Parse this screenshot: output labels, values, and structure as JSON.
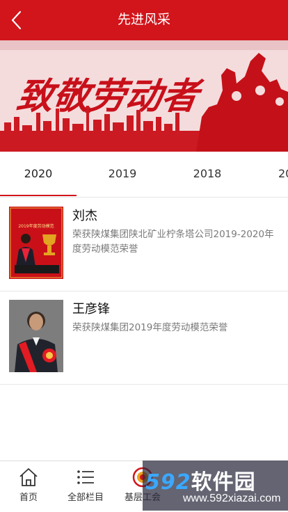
{
  "header": {
    "title": "先进风采",
    "back_icon": "chevron-left-icon"
  },
  "banner": {
    "slogan": "致敬劳动者",
    "colors": {
      "primary": "#d2141b",
      "background": "#f6dfe0"
    }
  },
  "tabs": {
    "items": [
      {
        "label": "2020",
        "active": true
      },
      {
        "label": "2019",
        "active": false
      },
      {
        "label": "2018",
        "active": false
      },
      {
        "label": "20",
        "active": false
      }
    ]
  },
  "list": {
    "items": [
      {
        "name": "刘杰",
        "description": "荣获陕煤集团陕北矿业柠条塔公司2019-2020年度劳动模范荣誉",
        "thumb_caption": "2019年度劳动模范"
      },
      {
        "name": "王彦锋",
        "description": "荣获陕煤集团2019年度劳动模范荣誉"
      }
    ]
  },
  "bottom_nav": {
    "items": [
      {
        "label": "首页",
        "icon": "home-icon"
      },
      {
        "label": "全部栏目",
        "icon": "list-icon"
      },
      {
        "label": "基层工会",
        "icon": "union-logo-icon"
      }
    ]
  },
  "watermark": {
    "logo_num": "592",
    "logo_text": "软件园",
    "url": "www.592xiazai.com"
  }
}
